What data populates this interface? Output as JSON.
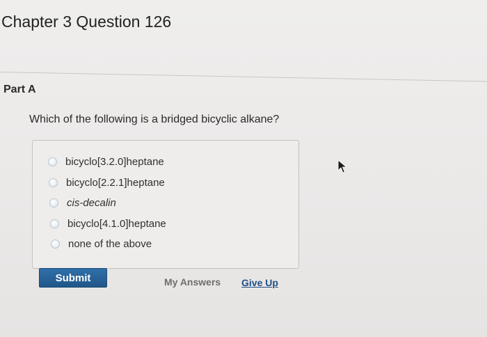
{
  "header": {
    "chapter_title": "Chapter 3 Question 126"
  },
  "part": {
    "label": "Part A"
  },
  "question": {
    "text": "Which of the following is a bridged bicyclic alkane?",
    "options": [
      {
        "label": "bicyclo[3.2.0]heptane",
        "selected": false
      },
      {
        "label": "bicyclo[2.2.1]heptane",
        "selected": false
      },
      {
        "label": "cis-decalin",
        "selected": false
      },
      {
        "label": "bicyclo[4.1.0]heptane",
        "selected": false
      },
      {
        "label": "none of the above",
        "selected": false
      }
    ]
  },
  "actions": {
    "submit_label": "Submit",
    "my_answers_label": "My Answers",
    "give_up_label": "Give Up"
  },
  "colors": {
    "submit_bg": "#2b6599",
    "link": "#1f4f86",
    "background": "#eceae9"
  },
  "icons": {
    "pointer": "mouse-pointer-icon",
    "radio": "radio-button-icon"
  }
}
